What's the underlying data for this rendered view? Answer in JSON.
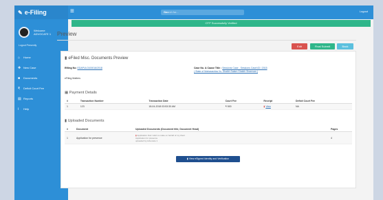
{
  "app": {
    "title": "e-Filing"
  },
  "profile": {
    "welcome": "Welcome",
    "user": "ADVOCATE 1",
    "status": "Logout Presently"
  },
  "sidebar": {
    "items": [
      {
        "label": "Home",
        "icon": "home-icon"
      },
      {
        "label": "New Case",
        "icon": "file-plus-icon"
      },
      {
        "label": "Documents",
        "icon": "document-icon"
      },
      {
        "label": "Deficit Court Fee",
        "icon": "rupee-icon"
      },
      {
        "label": "Reports",
        "icon": "report-icon",
        "has_caret": true
      },
      {
        "label": "Help",
        "icon": "info-icon"
      }
    ]
  },
  "topbar": {
    "search_placeholder": "Search for...",
    "go_label": "Go",
    "logout_label": "Logout"
  },
  "alert": {
    "text": "OTP Successfully Verified"
  },
  "page": {
    "title": "Preview"
  },
  "actions": {
    "edit": "Edit",
    "print": "Final Submit",
    "back": "Back"
  },
  "panel": {
    "title": "eFiled Misc. Documents Preview",
    "efiling_no_label": "Efiling No:",
    "efiling_no": "EDAPUL0100016/2018",
    "efiling_status": "eFiling Matters",
    "case_label": "Case No. & Cause Title :",
    "case_no": "Sessions Case - Sessions Case/43 / 2015",
    "case_title": "( State of Maharashtra Vs. Shaikh Salam Shaikh Shamsan )"
  },
  "payment": {
    "title": "Payment Details",
    "headers": [
      "#",
      "Transaction Number",
      "Transaction Date",
      "Court Fee",
      "Receipt",
      "Deficit Court Fee"
    ],
    "rows": [
      {
        "no": "1",
        "txn": "123",
        "date": "18-04-2018 03:53:30 AM",
        "fee": "₹ 500",
        "receipt": "View",
        "deficit": "NA"
      }
    ]
  },
  "docs": {
    "title": "Uploaded Documents",
    "headers": [
      "#",
      "Document",
      "Uploaded Documents (Document title, Document Head)",
      "Pages"
    ],
    "rows": [
      {
        "no": "1",
        "doc": "Application for presence",
        "line1": "Application that I wish to make on behalf of my client",
        "line2": "Application for presence",
        "line3": "uploaded by Advocate 1",
        "pages": "4"
      }
    ]
  },
  "verify_button": "View eSigned Identity and Verification"
}
